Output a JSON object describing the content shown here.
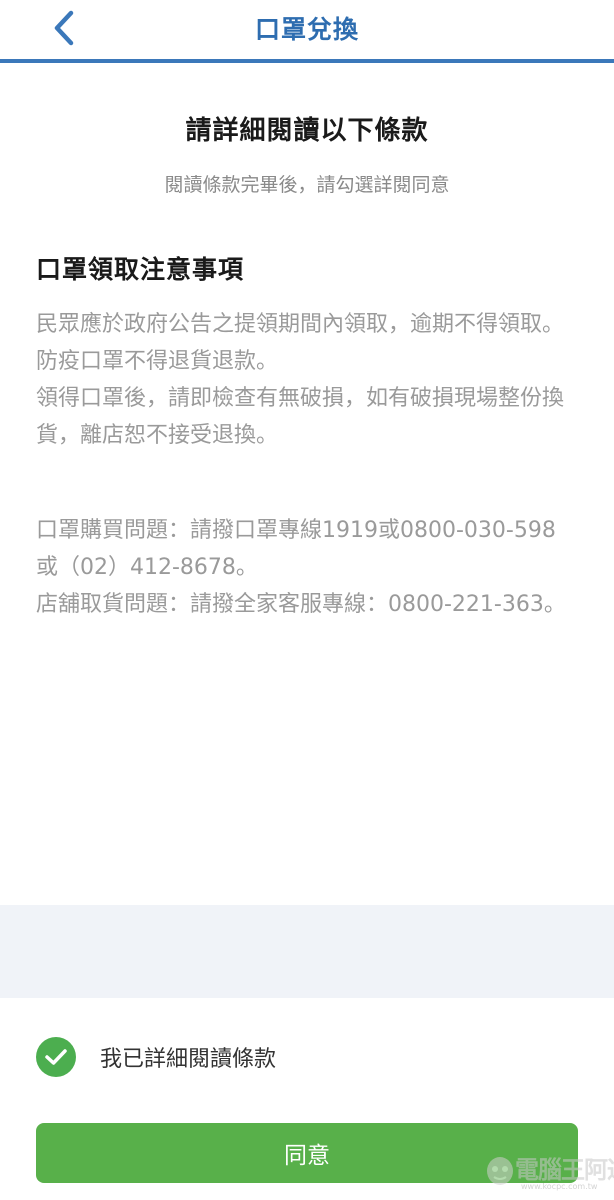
{
  "header": {
    "title": "口罩兌換",
    "back_icon": "chevron-left-icon",
    "accent_color": "#3b78ba"
  },
  "main": {
    "title": "請詳細閱讀以下條款",
    "subtitle": "閱讀條款完畢後，請勾選詳閱同意",
    "section_heading": "口罩領取注意事項",
    "terms_group_1": [
      "民眾應於政府公告之提領期間內領取，逾期不得領取。",
      "防疫口罩不得退貨退款。",
      "領得口罩後，請即檢查有無破損，如有破損現場整份換貨，離店恕不接受退換。"
    ],
    "terms_group_2": [
      "口罩購買問題：請撥口罩專線1919或0800-030-598或（02）412-8678。",
      "店舖取貨問題：請撥全家客服專線：0800-221-363。"
    ]
  },
  "agreement": {
    "checkbox_label": "我已詳細閱讀條款",
    "checked": true,
    "check_icon": "checkmark-icon",
    "check_color": "#4cae4f"
  },
  "footer": {
    "agree_button_label": "同意",
    "button_color": "#58b04a"
  },
  "watermark": {
    "text": "電腦王阿達",
    "sub": "www.kocpc.com.tw"
  }
}
